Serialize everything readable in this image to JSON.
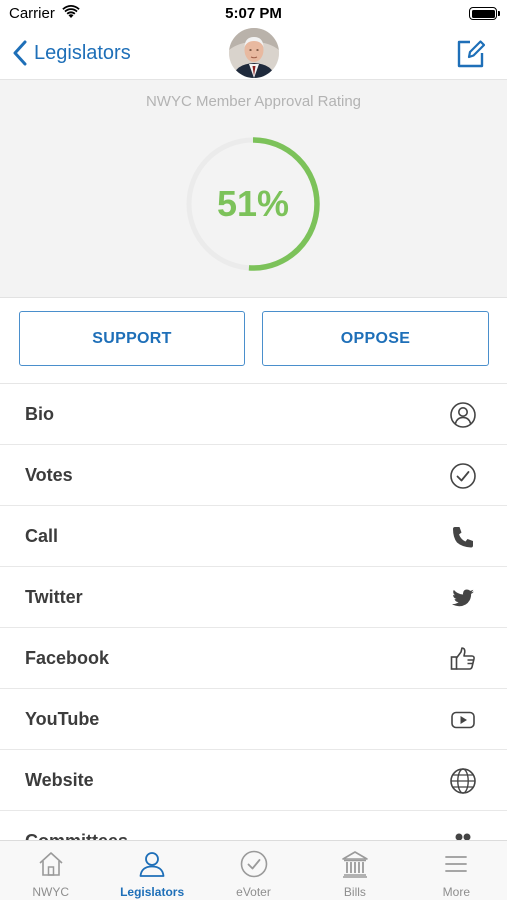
{
  "status_bar": {
    "carrier": "Carrier",
    "time": "5:07 PM"
  },
  "nav": {
    "back_label": "Legislators",
    "avatar_icon": "legislator-portrait",
    "edit_icon": "edit-icon"
  },
  "rating": {
    "label": "NWYC Member Approval Rating",
    "value_text": "51%",
    "fraction": 0.51,
    "color": "#7cc25a",
    "track_color": "#ebebeb"
  },
  "actions": {
    "support_label": "SUPPORT",
    "oppose_label": "OPPOSE",
    "accent": "#1e6fb8"
  },
  "menu": {
    "items": [
      {
        "label": "Bio",
        "icon": "person-circle-icon"
      },
      {
        "label": "Votes",
        "icon": "check-circle-icon"
      },
      {
        "label": "Call",
        "icon": "phone-icon"
      },
      {
        "label": "Twitter",
        "icon": "twitter-icon"
      },
      {
        "label": "Facebook",
        "icon": "thumbs-up-icon"
      },
      {
        "label": "YouTube",
        "icon": "youtube-icon"
      },
      {
        "label": "Website",
        "icon": "globe-icon"
      },
      {
        "label": "Committees",
        "icon": "people-icon"
      }
    ]
  },
  "tab_bar": {
    "active": "Legislators",
    "tabs": [
      {
        "label": "NWYC",
        "icon": "home-icon"
      },
      {
        "label": "Legislators",
        "icon": "person-icon"
      },
      {
        "label": "eVoter",
        "icon": "check-circle-icon"
      },
      {
        "label": "Bills",
        "icon": "capitol-icon"
      },
      {
        "label": "More",
        "icon": "menu-icon"
      }
    ]
  }
}
